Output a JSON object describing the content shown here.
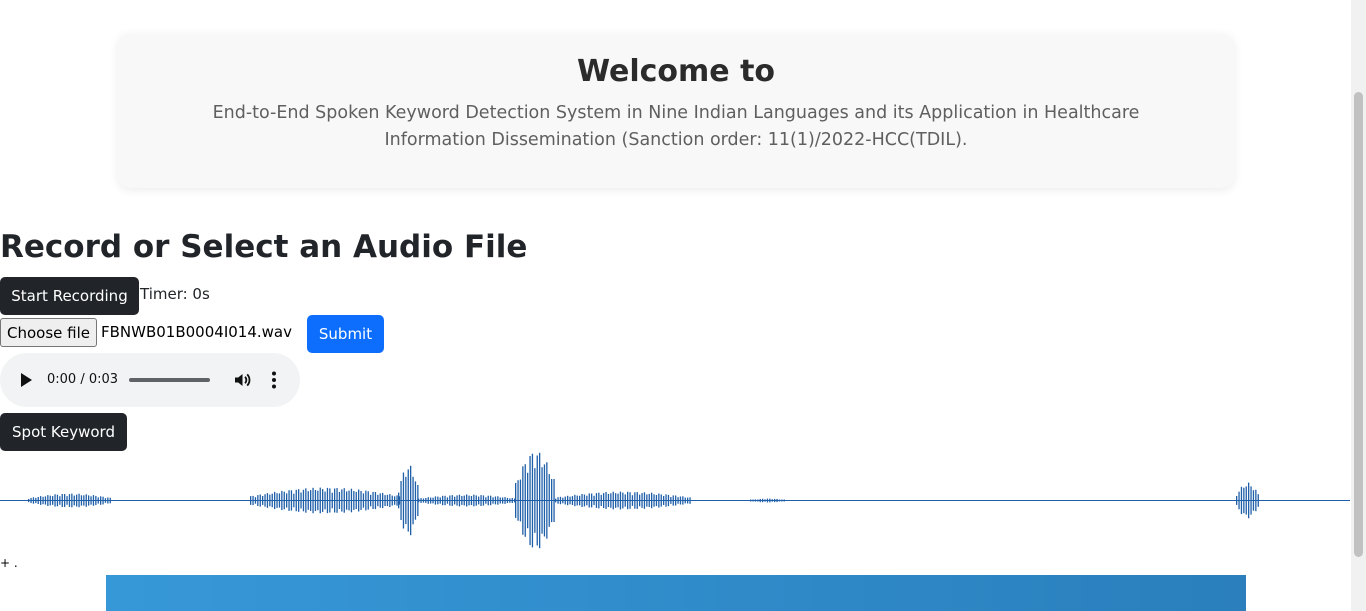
{
  "header": {
    "title": "Welcome to",
    "subtitle": "End-to-End Spoken Keyword Detection System in Nine Indian Languages and its Application in Healthcare Information Dissemination (Sanction order: 11(1)/2022-HCC(TDIL)."
  },
  "recorder": {
    "section_title": "Record or Select an Audio File",
    "start_label": "Start Recording",
    "timer_text": "Timer: 0s",
    "choose_file_label": "Choose file",
    "file_name": "FBNWB01B0004I014.wav",
    "submit_label": "Submit",
    "spot_label": "Spot Keyword"
  },
  "audio": {
    "time_text": "0:00 / 0:03",
    "progress": 0
  },
  "waveform": {
    "color": "#1f5fa8"
  },
  "footnote": "+ .",
  "colors": {
    "primary": "#0d6efd",
    "dark_button": "#212529",
    "banner": "#3798d8"
  }
}
